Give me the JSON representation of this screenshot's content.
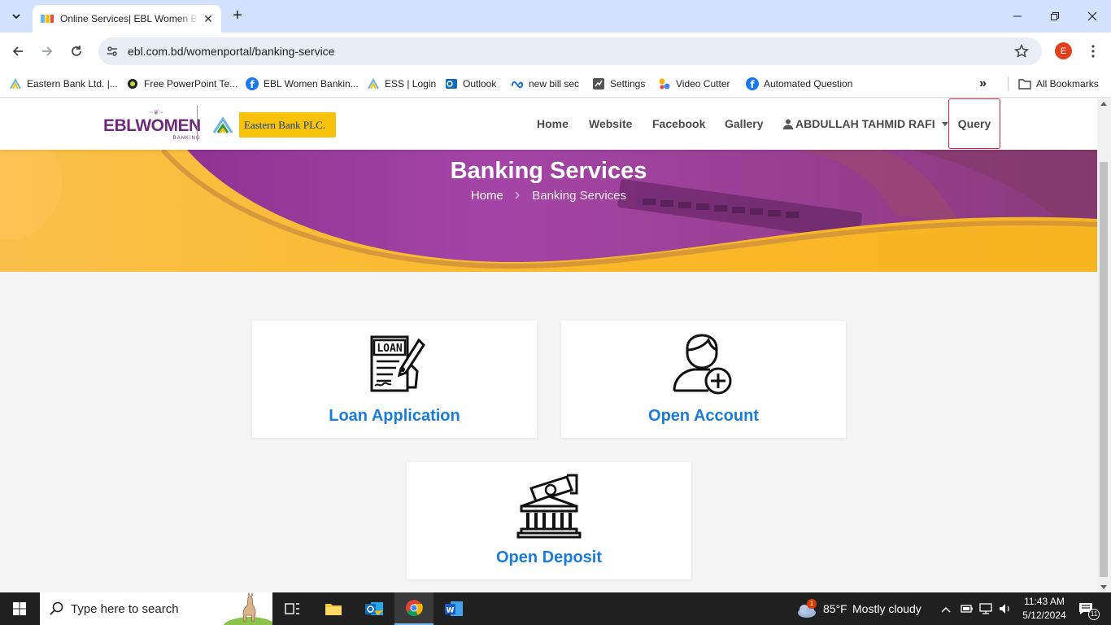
{
  "browser": {
    "tab_title": "Online Services| EBL Women Banking",
    "url": "ebl.com.bd/womenportal/banking-service",
    "profile_initial": "E",
    "bookmarks": [
      {
        "label": "Eastern Bank Ltd. |...",
        "icon": "ebl-logo-icon"
      },
      {
        "label": "Free PowerPoint Te...",
        "icon": "slide-icon"
      },
      {
        "label": "EBL Women Bankin...",
        "icon": "facebook-icon"
      },
      {
        "label": "ESS | Login",
        "icon": "ebl-logo-icon"
      },
      {
        "label": "Outlook",
        "icon": "outlook-icon"
      },
      {
        "label": "new bill sec",
        "icon": "meta-icon"
      },
      {
        "label": "Settings",
        "icon": "settings-page-icon"
      },
      {
        "label": "Video Cutter",
        "icon": "video-cutter-icon"
      },
      {
        "label": "Automated Question",
        "icon": "facebook-icon"
      }
    ],
    "all_bookmarks_label": "All Bookmarks"
  },
  "site": {
    "logo_ebl_main": "EBL",
    "logo_ebl_women": "WOMEN",
    "logo_ebl_sub": "BANKING",
    "logo_eastern_text": "Eastern Bank PLC.",
    "nav": {
      "home": "Home",
      "website": "Website",
      "facebook": "Facebook",
      "gallery": "Gallery",
      "user": "ABDULLAH TAHMID RAFI",
      "query": "Query"
    },
    "hero": {
      "title": "Banking Services",
      "crumb_home": "Home",
      "crumb_sep": ">",
      "crumb_current": "Banking Services"
    },
    "cards": [
      {
        "label": "Loan Application",
        "icon": "loan-document-icon"
      },
      {
        "label": "Open Account",
        "icon": "add-user-icon"
      },
      {
        "label": "Open Deposit",
        "icon": "bank-deposit-icon"
      }
    ],
    "loan_icon_text": "LOAN"
  },
  "taskbar": {
    "search_placeholder": "Type here to search",
    "weather_temp": "85°F",
    "weather_desc": "Mostly cloudy",
    "weather_badge": "1",
    "time": "11:43 AM",
    "date": "5/12/2024",
    "notification_count": "11"
  },
  "colors": {
    "accent_blue": "#1a7cd6",
    "brand_purple": "#6c2c7a",
    "brand_yellow": "#f7c20c",
    "query_border": "#d7263d"
  }
}
